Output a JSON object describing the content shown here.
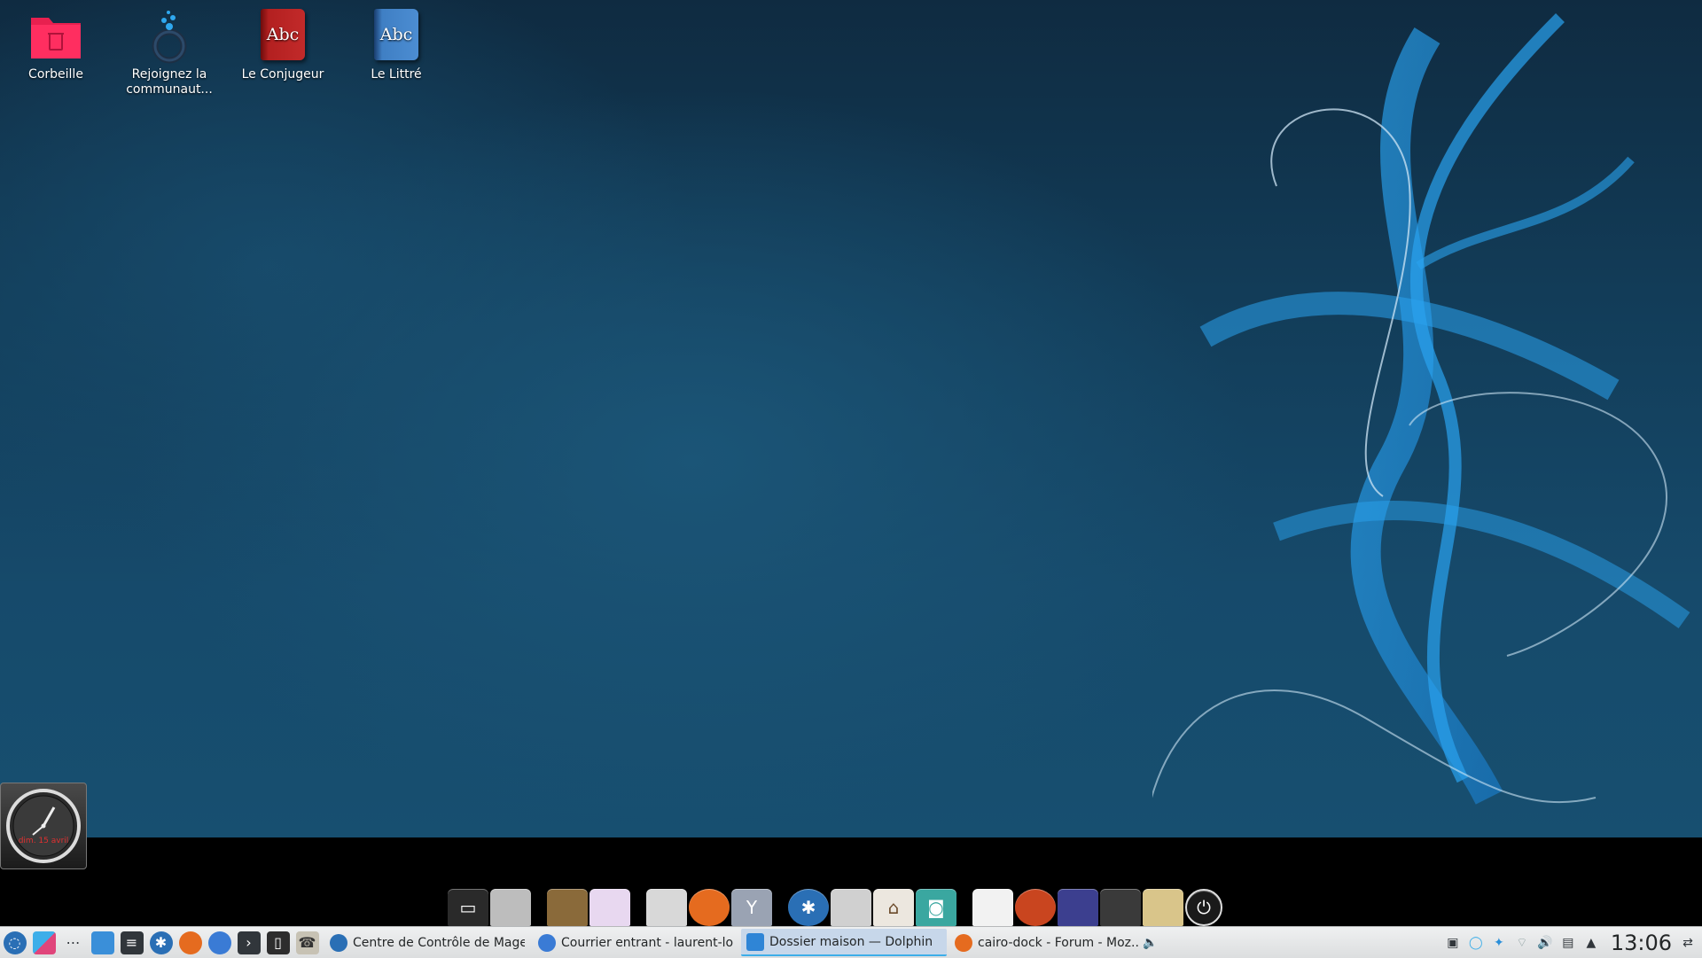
{
  "desktop": {
    "icons": [
      {
        "label": "Corbeille",
        "icon": "trash-folder-icon"
      },
      {
        "label": "Rejoignez la communaut...",
        "icon": "community-icon"
      },
      {
        "label": "Le Conjugeur",
        "icon": "red-book-icon",
        "glyph": "Abc"
      },
      {
        "label": "Le Littré",
        "icon": "blue-book-icon",
        "glyph": "Abc"
      }
    ]
  },
  "clock_widget": {
    "date_text": "dim. 15 avril"
  },
  "dock": {
    "items": [
      "terminal-icon",
      "printer-icon",
      "gimp-icon",
      "writer-icon",
      "file-icon",
      "firefox-icon",
      "vlc-icon",
      "settings-gear-icon",
      "folder-icon",
      "home-icon",
      "screenshot-icon",
      "document-icon",
      "mageia-icon",
      "monitor-ram-icon",
      "switch-icon",
      "notification-icon",
      "power-icon"
    ]
  },
  "taskbar": {
    "tasks": [
      {
        "label": "Centre de Contrôle de Magei...",
        "icon": "mageia-control-center-icon",
        "color": "#2a6fb5"
      },
      {
        "label": "Courrier entrant - laurent-loi...",
        "icon": "thunderbird-icon",
        "color": "#3a7bd5"
      },
      {
        "label": "Dossier maison — Dolphin",
        "icon": "dolphin-folder-icon",
        "color": "#2f85d6",
        "active": true
      },
      {
        "label": "cairo-dock - Forum - Moz...",
        "icon": "firefox-icon",
        "color": "#e56b1f"
      }
    ],
    "clock": "13:06"
  },
  "colors": {
    "accent": "#3daee9",
    "panel": "#eff0f1",
    "dock_band": "#000000"
  }
}
